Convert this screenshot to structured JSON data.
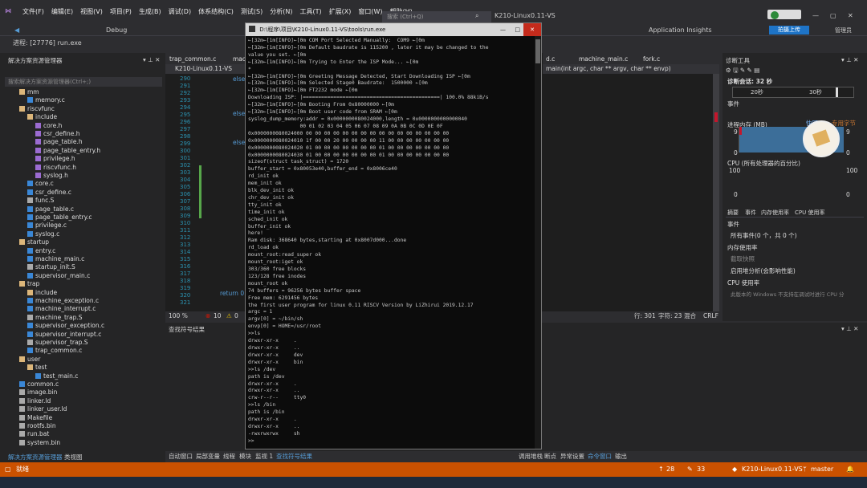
{
  "menu": {
    "items": [
      "文件(F)",
      "编辑(E)",
      "视图(V)",
      "项目(P)",
      "生成(B)",
      "调试(D)",
      "体系结构(C)",
      "测试(S)",
      "分析(N)",
      "工具(T)",
      "扩展(X)",
      "窗口(W)",
      "帮助(H)"
    ],
    "search_placeholder": "搜索 (Ctrl+Q)",
    "solution_name": "K210-Linux0.11-VS",
    "process": "进程: [27776] run.exe",
    "debug_config": "Debug",
    "app_insights": "Application Insights",
    "live_share": "拍摄上传",
    "admin": "管理员"
  },
  "solution_explorer": {
    "title": "解决方案资源管理器",
    "search_placeholder": "搜索解决方案资源管理器(Ctrl+;)",
    "items": [
      {
        "label": "mm",
        "type": "f",
        "indent": 1
      },
      {
        "label": "memory.c",
        "type": "c",
        "indent": 2
      },
      {
        "label": "riscvfunc",
        "type": "f",
        "indent": 1
      },
      {
        "label": "include",
        "type": "f",
        "indent": 2
      },
      {
        "label": "core.h",
        "type": "h",
        "indent": 3
      },
      {
        "label": "csr_define.h",
        "type": "h",
        "indent": 3
      },
      {
        "label": "page_table.h",
        "type": "h",
        "indent": 3
      },
      {
        "label": "page_table_entry.h",
        "type": "h",
        "indent": 3
      },
      {
        "label": "privilege.h",
        "type": "h",
        "indent": 3
      },
      {
        "label": "riscvfunc.h",
        "type": "h",
        "indent": 3
      },
      {
        "label": "syslog.h",
        "type": "h",
        "indent": 3
      },
      {
        "label": "core.c",
        "type": "c",
        "indent": 2
      },
      {
        "label": "csr_define.c",
        "type": "c",
        "indent": 2
      },
      {
        "label": "func.S",
        "type": "s",
        "indent": 2
      },
      {
        "label": "page_table.c",
        "type": "c",
        "indent": 2
      },
      {
        "label": "page_table_entry.c",
        "type": "c",
        "indent": 2
      },
      {
        "label": "privilege.c",
        "type": "c",
        "indent": 2
      },
      {
        "label": "syslog.c",
        "type": "c",
        "indent": 2
      },
      {
        "label": "startup",
        "type": "f",
        "indent": 1
      },
      {
        "label": "entry.c",
        "type": "c",
        "indent": 2
      },
      {
        "label": "machine_main.c",
        "type": "c",
        "indent": 2
      },
      {
        "label": "startup_init.S",
        "type": "s",
        "indent": 2
      },
      {
        "label": "supervisor_main.c",
        "type": "c",
        "indent": 2
      },
      {
        "label": "trap",
        "type": "f",
        "indent": 1
      },
      {
        "label": "include",
        "type": "f",
        "indent": 2
      },
      {
        "label": "machine_exception.c",
        "type": "c",
        "indent": 2
      },
      {
        "label": "machine_interrupt.c",
        "type": "c",
        "indent": 2
      },
      {
        "label": "machine_trap.S",
        "type": "s",
        "indent": 2
      },
      {
        "label": "supervisor_exception.c",
        "type": "c",
        "indent": 2
      },
      {
        "label": "supervisor_interrupt.c",
        "type": "c",
        "indent": 2
      },
      {
        "label": "supervisor_trap.S",
        "type": "s",
        "indent": 2
      },
      {
        "label": "trap_common.c",
        "type": "c",
        "indent": 2
      },
      {
        "label": "user",
        "type": "f",
        "indent": 1
      },
      {
        "label": "test",
        "type": "f",
        "indent": 2
      },
      {
        "label": "test_main.c",
        "type": "c",
        "indent": 3
      },
      {
        "label": "common.c",
        "type": "c",
        "indent": 1
      },
      {
        "label": "image.bin",
        "type": "s",
        "indent": 1
      },
      {
        "label": "linker.ld",
        "type": "s",
        "indent": 1
      },
      {
        "label": "linker_user.ld",
        "type": "s",
        "indent": 1
      },
      {
        "label": "Makefile",
        "type": "s",
        "indent": 1
      },
      {
        "label": "rootfs.bin",
        "type": "s",
        "indent": 1
      },
      {
        "label": "run.bat",
        "type": "s",
        "indent": 1
      },
      {
        "label": "system.bin",
        "type": "s",
        "indent": 1
      }
    ],
    "bottom_tabs": [
      "解决方案资源管理器",
      "类视图"
    ]
  },
  "editor": {
    "tabs": [
      "trap_common.c",
      "machi",
      "d.c",
      "machine_main.c",
      "fork.c"
    ],
    "project": "K210-Linux0.11-VS",
    "function": "main(int argc, char ** argv, char ** envp)",
    "line_numbers": [
      "290",
      "291",
      "292",
      "293",
      "294",
      "295",
      "296",
      "297",
      "298",
      "299",
      "300",
      "301",
      "302",
      "303",
      "304",
      "305",
      "306",
      "307",
      "308",
      "309",
      "310",
      "311",
      "312",
      "313",
      "314",
      "315",
      "316",
      "317",
      "318",
      "319",
      "320",
      "321"
    ],
    "code_snippets": {
      "l291": "else",
      "l295": "else",
      "l299": "else",
      "l320": "return 0"
    },
    "zoom": "100 %",
    "errors": "10",
    "warnings": "0",
    "line": "行: 301",
    "col": "字符: 23",
    "mix": "混合",
    "crlf": "CRLF"
  },
  "find_panel": {
    "title": "查找符号结果"
  },
  "console": {
    "title": "D:\\程序\\项目\\K210-Linux0.11-VS\\tools\\run.exe",
    "lines": [
      "←[32m←[1m[INFO]←[0m COM Port Selected Manually:  COM9 ←[0m",
      "←[32m←[1m[INFO]←[0m Default baudrate is 115200 , later it may be changed to the",
      "value you set. ←[0m",
      "←[32m←[1m[INFO]←[0m Trying to Enter the ISP Mode... ←[0m",
      "*",
      "←[32m←[1m[INFO]←[0m Greeting Message Detected, Start Downloading ISP ←[0m",
      "←[32m←[1m[INFO]←[0m Selected Stage0 Baudrate:  1500000 ←[0m",
      "←[32m←[1m[INFO]←[0m FT2232 mode ←[0m",
      "Downloading ISP: |=============================================| 100.0% 88kiB/s",
      "←[32m←[1m[INFO]←[0m Booting From 0x80000000 ←[0m",
      "←[32m←[1m[INFO]←[0m Boot user code from SRAM ←[0m",
      "syslog_dump_memory:addr = 0x0000000080024000,length = 0x0000000000000040",
      "                 00 01 02 03 04 05 06 07 08 09 0A 0B 0C 0D 0E 0F",
      "0x0000000080024000 00 00 00 00 00 00 00 00 00 00 00 00 00 00 00 00",
      "0x0000000080024010 1f 00 00 20 00 00 00 00 11 00 00 00 00 00 00 00",
      "0x0000000080024020 01 00 00 00 00 00 00 00 01 00 00 00 00 00 00 00",
      "0x0000000080024030 01 00 00 00 00 00 00 00 01 00 00 00 00 00 00 00",
      "sizeof(struct task_struct) = 1720",
      "buffer_start = 0x80053e40,buffer_end = 0x8006ce40",
      "rd_init ok",
      "mem_init ok",
      "blk_dev_init ok",
      "chr_dev_init ok",
      "tty_init ok",
      "time_init ok",
      "sched_init ok",
      "buffer_init ok",
      "here!",
      "Ram disk: 368640 bytes,starting at 0x8007d000...done",
      "rd_load ok",
      "mount_root:read_super ok",
      "mount_root:iget ok",
      "303/360 free blocks",
      "123/128 free inodes",
      "mount_root ok",
      "74 buffers = 96256 bytes buffer space",
      "Free mem: 6291456 bytes",
      "the first user program for linux 0.11 RISCV Version by LiZhirui 2019.12.17",
      "argc = 1",
      "argv[0] = ~/bin/sh",
      "envp[0] = HOME=/usr/root",
      ">>ls",
      "drwxr-xr-x     .",
      "drwxr-xr-x     ..",
      "drwxr-xr-x     dev",
      "drwxr-xr-x     bin",
      ">>ls /dev",
      "path is /dev",
      "drwxr-xr-x     .",
      "drwxr-xr-x     ..",
      "crw-r--r--     tty0",
      ">>ls /bin",
      "path is /bin",
      "drwxr-xr-x     .",
      "drwxr-xr-x     ..",
      "-rwxrwxrwx     sh",
      ">>"
    ]
  },
  "diagnostics": {
    "title": "诊断工具",
    "session": "诊断会话: 32 秒",
    "t20": "20秒",
    "t30": "30秒",
    "events": "事件",
    "memory": "进程内存 (MB)",
    "snapshot": "快照",
    "private": "专用字节",
    "mem_max": "9",
    "mem_min": "0",
    "cpu": "CPU (所有处理器的百分比)",
    "cpu_max": "100",
    "cpu_min": "0",
    "tabs": [
      "摘要",
      "事件",
      "内存使用率",
      "CPU 使用率"
    ],
    "events_h": "事件",
    "all_events": "所有事件(0 个，共 0 个)",
    "memusage_h": "内存使用率",
    "take_snapshot": "截取快照",
    "heap_profile": "启用堆分析(会影响性能)",
    "cpu_h": "CPU 使用率",
    "cpu_note": "此版本的 Windows 不支持在调试时进行 CPU 分"
  },
  "bottom": {
    "tabs": [
      "自动窗口",
      "局部变量",
      "线程",
      "模块",
      "监视 1",
      "查找符号结果"
    ],
    "tabs_right": [
      "调用堆栈",
      "断点",
      "异常设置",
      "命令窗口",
      "输出"
    ]
  },
  "status": {
    "ready": "就绪",
    "up": "28",
    "pen": "33",
    "repo": "K210-Linux0.11-VS",
    "branch": "master"
  }
}
